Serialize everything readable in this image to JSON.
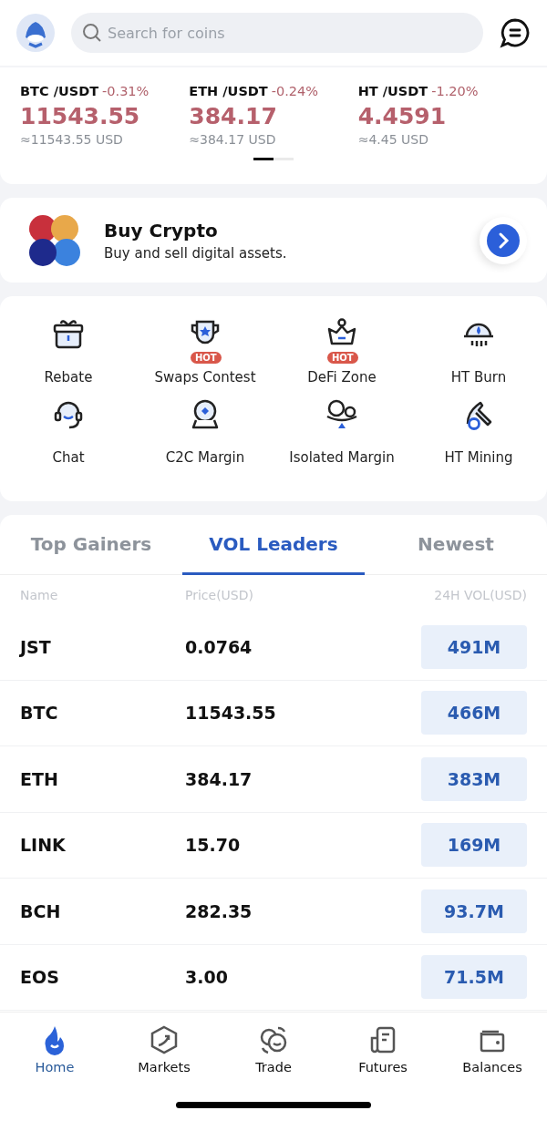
{
  "search": {
    "placeholder": "Search for coins"
  },
  "tickers": [
    {
      "pair": "BTC /USDT",
      "change": "-0.31%",
      "price": "11543.55",
      "usd": "≈11543.55 USD"
    },
    {
      "pair": "ETH /USDT",
      "change": "-0.24%",
      "price": "384.17",
      "usd": "≈384.17 USD"
    },
    {
      "pair": "HT /USDT",
      "change": "-1.20%",
      "price": "4.4591",
      "usd": "≈4.45 USD"
    }
  ],
  "ticker_pages": [
    {
      "selected": true
    },
    {
      "selected": false
    }
  ],
  "buy_crypto": {
    "title": "Buy Crypto",
    "subtitle": "Buy and sell digital assets."
  },
  "shortcuts": [
    {
      "label": "Rebate"
    },
    {
      "label": "Swaps Contest",
      "badge": "HOT"
    },
    {
      "label": "DeFi Zone",
      "badge": "HOT"
    },
    {
      "label": "HT Burn"
    },
    {
      "label": "Chat"
    },
    {
      "label": "C2C Margin"
    },
    {
      "label": "Isolated Margin"
    },
    {
      "label": "HT Mining"
    }
  ],
  "market_tabs": [
    {
      "label": "Top Gainers",
      "selected": false
    },
    {
      "label": "VOL Leaders",
      "selected": true
    },
    {
      "label": "Newest",
      "selected": false
    }
  ],
  "market_columns": [
    "Name",
    "Price(USD)",
    "24H VOL(USD)"
  ],
  "market_rows": [
    {
      "name": "JST",
      "price": "0.0764",
      "volume": "491M"
    },
    {
      "name": "BTC",
      "price": "11543.55",
      "volume": "466M"
    },
    {
      "name": "ETH",
      "price": "384.17",
      "volume": "383M"
    },
    {
      "name": "LINK",
      "price": "15.70",
      "volume": "169M"
    },
    {
      "name": "BCH",
      "price": "282.35",
      "volume": "93.7M"
    },
    {
      "name": "EOS",
      "price": "3.00",
      "volume": "71.5M"
    }
  ],
  "bottom_nav": [
    {
      "label": "Home",
      "selected": true
    },
    {
      "label": "Markets",
      "selected": false
    },
    {
      "label": "Trade",
      "selected": false
    },
    {
      "label": "Futures",
      "selected": false
    },
    {
      "label": "Balances",
      "selected": false
    }
  ]
}
